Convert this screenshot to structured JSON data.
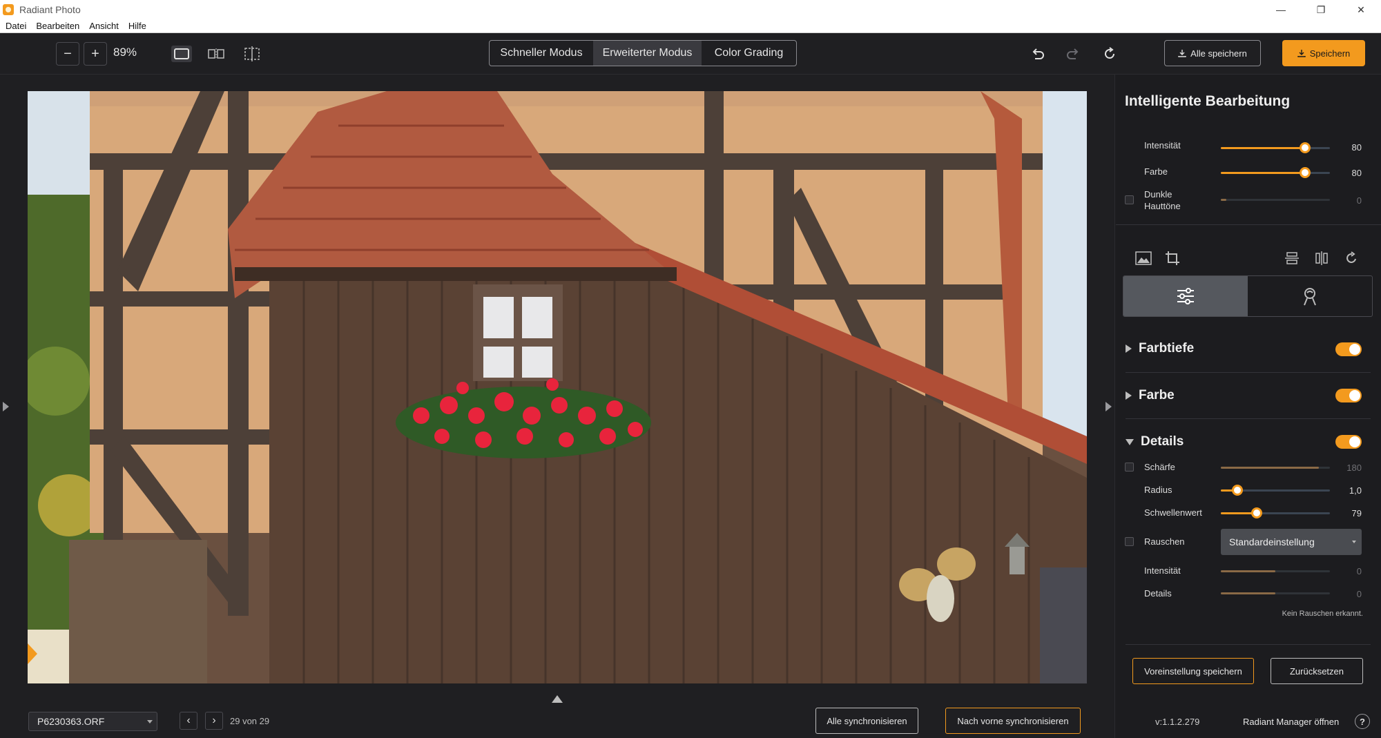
{
  "window": {
    "title": "Radiant Photo",
    "minimize": "—",
    "maximize": "❐",
    "close": "✕"
  },
  "menu": [
    "Datei",
    "Bearbeiten",
    "Ansicht",
    "Hilfe"
  ],
  "toolbar": {
    "zoom_out": "−",
    "zoom_in": "+",
    "zoom": "89%",
    "modes": [
      "Schneller Modus",
      "Erweiterter Modus",
      "Color Grading"
    ],
    "active_mode": "Erweiterter Modus",
    "save_all": "Alle speichern",
    "save": "Speichern"
  },
  "bottom": {
    "file": "P6230363.ORF",
    "prev": "‹",
    "next": "›",
    "count": "29 von 29",
    "sync_all": "Alle synchronisieren",
    "sync_forward": "Nach vorne synchronisieren"
  },
  "smart_edit": {
    "title": "Intelligente Bearbeitung",
    "intensity_label": "Intensität",
    "intensity": 80,
    "color_label": "Farbe",
    "color": 80,
    "dark_skin_label_1": "Dunkle",
    "dark_skin_label_2": "Hauttöne",
    "dark_skin": 0
  },
  "sections": {
    "farbtiefe": "Farbtiefe",
    "farbe": "Farbe",
    "details": "Details"
  },
  "details": {
    "sharpness_label": "Schärfe",
    "sharpness": "180",
    "sharpness_fraction": 0.9,
    "radius_label": "Radius",
    "radius": "1,0",
    "radius_fraction": 0.15,
    "threshold_label": "Schwellenwert",
    "threshold": "79",
    "threshold_fraction": 0.33,
    "noise_label": "Rauschen",
    "noise_mode": "Standardeinstellung",
    "noise_intensity_label": "Intensität",
    "noise_intensity": "0",
    "noise_details_label": "Details",
    "noise_details": "0",
    "note": "Kein Rauschen erkannt."
  },
  "footer": {
    "save_preset": "Voreinstellung speichern",
    "reset": "Zurücksetzen",
    "version": "v:1.1.2.279",
    "manager": "Radiant Manager öffnen",
    "help": "?"
  },
  "colors": {
    "accent": "#f39a1e",
    "background": "#1f1f22",
    "panel": "#1c1c1f"
  }
}
